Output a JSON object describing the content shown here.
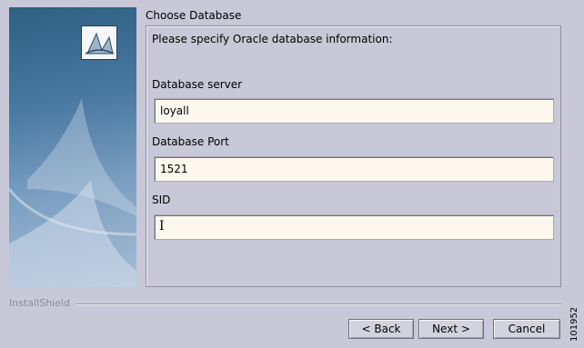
{
  "window": {
    "title": "Choose Database"
  },
  "panel": {
    "instruction": "Please specify Oracle database information:",
    "fields": [
      {
        "label": "Database server",
        "value": "loyall"
      },
      {
        "label": "Database Port",
        "value": "1521"
      },
      {
        "label": "SID",
        "value": ""
      }
    ]
  },
  "footer": {
    "brand": "InstallShield",
    "back_label": "< Back",
    "next_label": "Next >",
    "cancel_label": "Cancel"
  },
  "figure_number": "101952"
}
